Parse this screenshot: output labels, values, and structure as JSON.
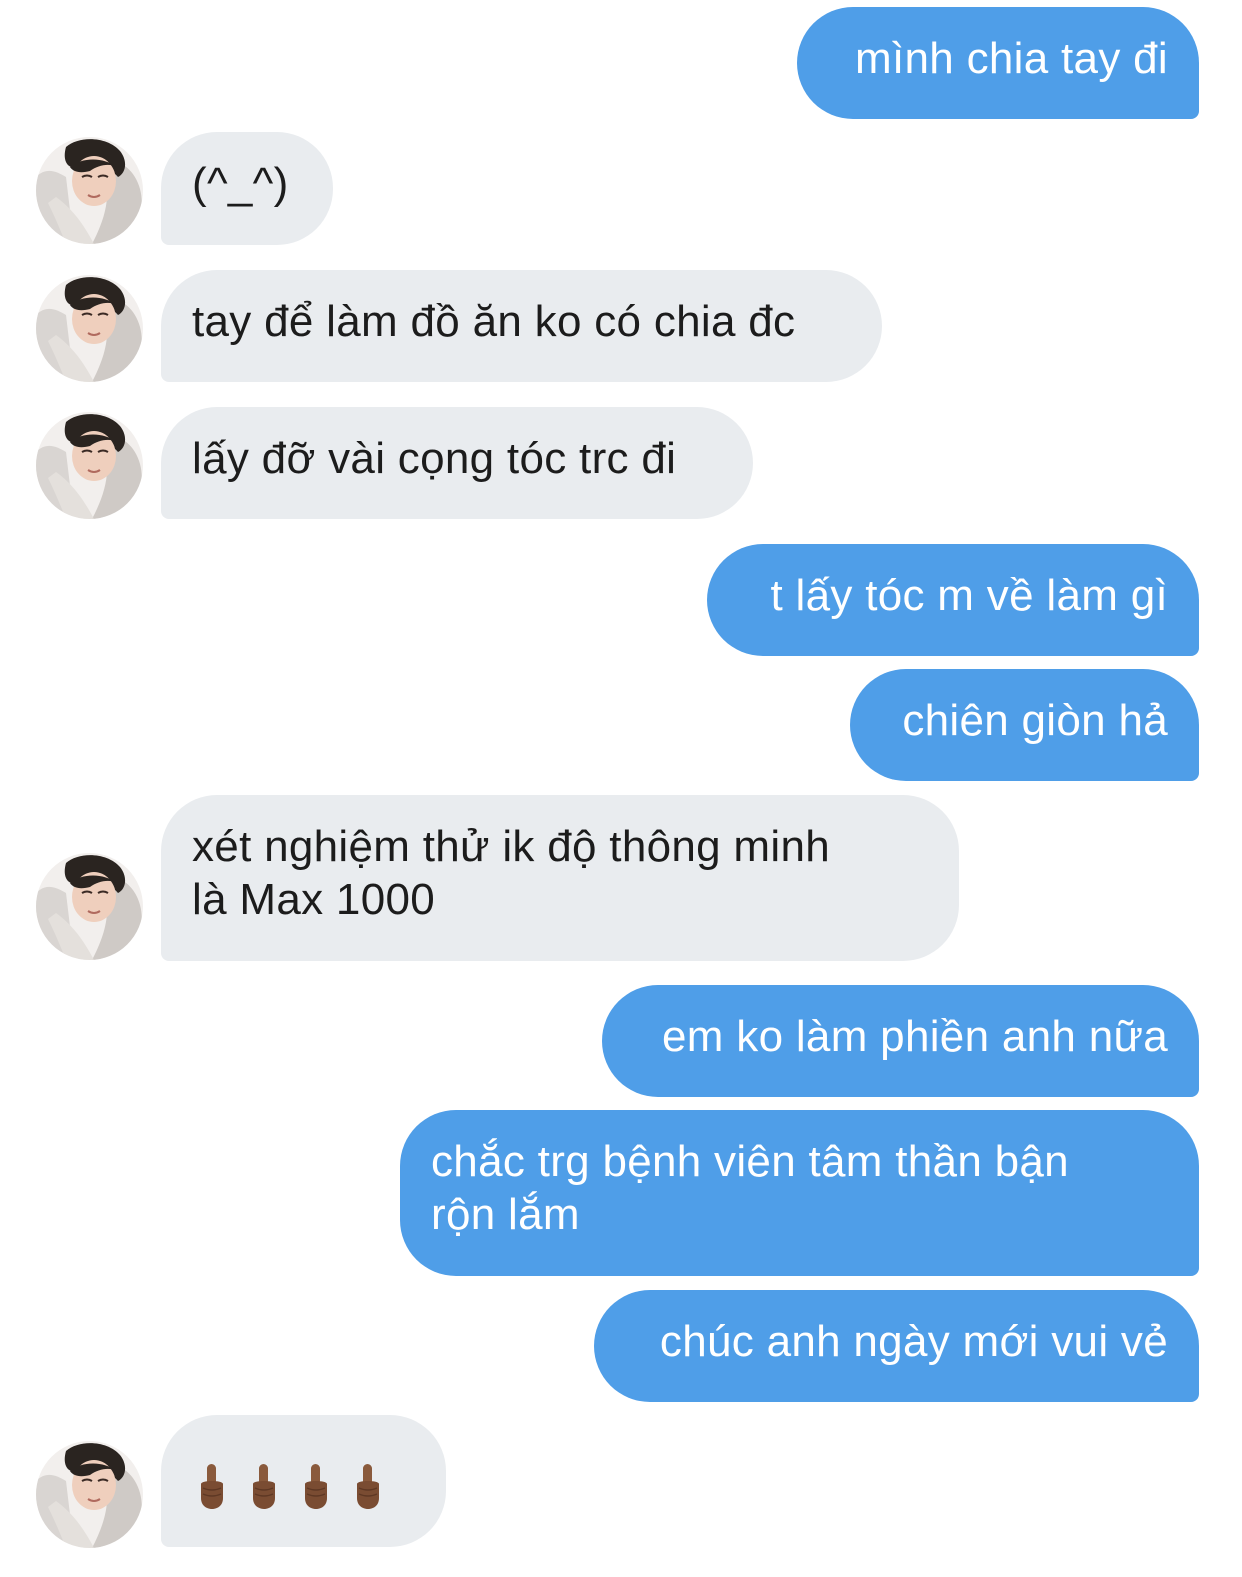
{
  "conversation": {
    "messages": [
      {
        "id": "m1",
        "side": "outgoing",
        "text": "mình chia tay đi"
      },
      {
        "id": "m2",
        "side": "incoming",
        "text": "(^_^)"
      },
      {
        "id": "m3",
        "side": "incoming",
        "text": "tay để làm đồ ăn ko có chia đc"
      },
      {
        "id": "m4",
        "side": "incoming",
        "text": "lấy đỡ vài cọng tóc trc đi"
      },
      {
        "id": "m5",
        "side": "outgoing",
        "text": "t lấy tóc m về làm gì"
      },
      {
        "id": "m6",
        "side": "outgoing",
        "text": "chiên giòn hả"
      },
      {
        "id": "m7",
        "side": "incoming",
        "text": "xét nghiệm thử ik độ thông minh\nlà Max 1000"
      },
      {
        "id": "m8",
        "side": "outgoing",
        "text": "em ko làm phiền anh nữa"
      },
      {
        "id": "m9",
        "side": "outgoing",
        "text": "chắc trg bệnh viên tâm thần bận\nrộn lắm"
      },
      {
        "id": "m10",
        "side": "outgoing",
        "text": "chúc anh ngày mới vui vẻ"
      },
      {
        "id": "m11",
        "side": "incoming",
        "text": "",
        "emoji": "middle-finger-emoji",
        "emoji_count": 4,
        "skin_tone": "medium-dark"
      }
    ]
  },
  "theme": {
    "outgoing_bubble": "#4f9ee8",
    "incoming_bubble": "#e9ecef",
    "outgoing_text": "#ffffff",
    "incoming_text": "#1c1c1c"
  },
  "avatar": {
    "icon": "contact-avatar-photo"
  }
}
